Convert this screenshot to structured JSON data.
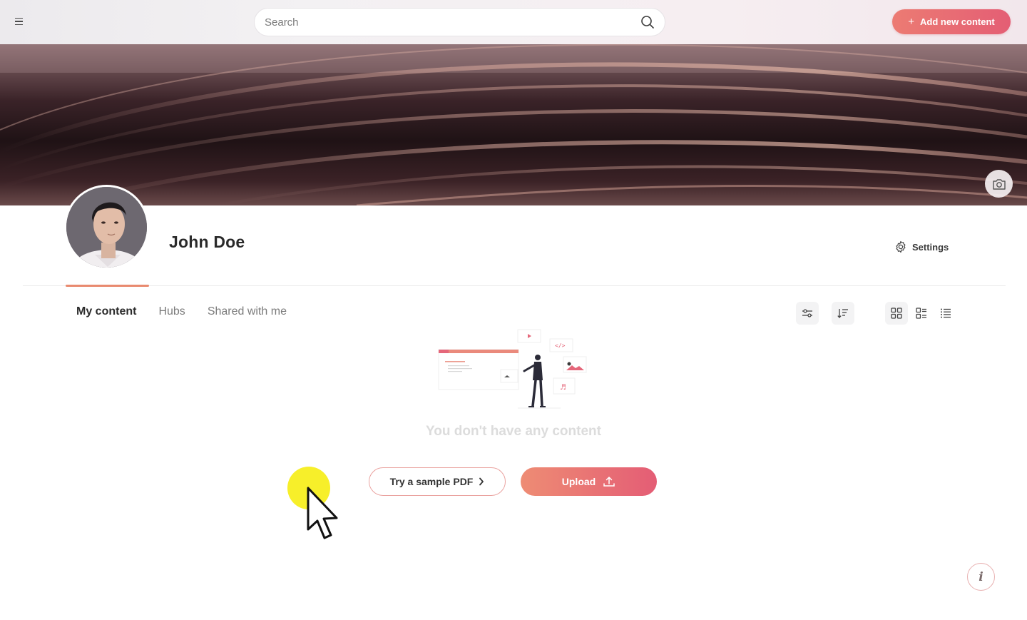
{
  "header": {
    "search_placeholder": "Search",
    "add_button_label": "Add new content",
    "add_button_icon": "plus-icon"
  },
  "profile": {
    "name": "John Doe",
    "settings_label": "Settings"
  },
  "tabs": [
    {
      "label": "My content",
      "active": true
    },
    {
      "label": "Hubs",
      "active": false
    },
    {
      "label": "Shared with me",
      "active": false
    }
  ],
  "toolbar": {
    "icons": [
      "filter-icon",
      "sort-icon",
      "grid-view-icon",
      "compact-list-view-icon",
      "list-view-icon"
    ],
    "active_view": "grid-view-icon"
  },
  "empty_state": {
    "message": "You don't have any content",
    "sample_button_label": "Try a sample PDF",
    "upload_button_label": "Upload"
  },
  "colors": {
    "accent_start": "#ec7b73",
    "accent_end": "#e45e74",
    "tab_underline": "#e98a6f"
  }
}
